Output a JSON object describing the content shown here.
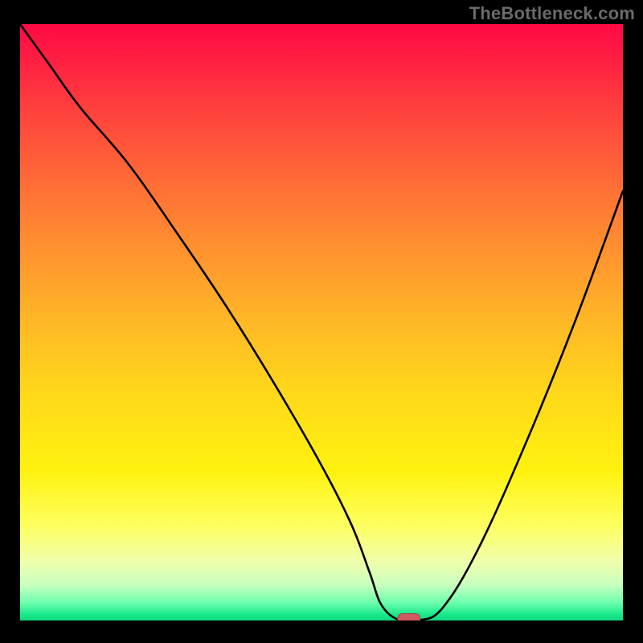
{
  "watermark": "TheBottleneck.com",
  "chart_data": {
    "type": "line",
    "title": "",
    "xlabel": "",
    "ylabel": "",
    "x": [
      0,
      5,
      10,
      18,
      26,
      34,
      42,
      50,
      55,
      58,
      60,
      63,
      66,
      70,
      76,
      84,
      92,
      100
    ],
    "values": [
      100,
      93,
      86,
      76.5,
      65,
      53,
      40,
      26,
      16,
      8,
      2.5,
      0,
      0,
      2,
      12,
      30,
      50,
      72
    ],
    "xlim": [
      0,
      100
    ],
    "ylim": [
      0,
      100
    ],
    "marker": {
      "x": 64.5,
      "y": 0
    },
    "background_gradient": [
      "#ff0a44",
      "#ffd81a",
      "#18e98a"
    ]
  }
}
